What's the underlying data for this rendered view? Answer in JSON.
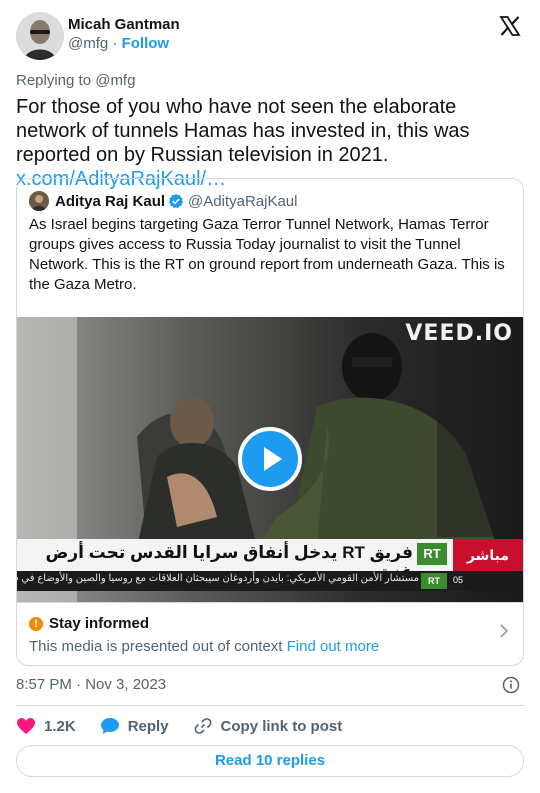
{
  "author": {
    "name": "Micah Gantman",
    "handle": "@mfg",
    "separator": "·",
    "follow_label": "Follow"
  },
  "tweet": {
    "reply_to": "Replying to @mfg",
    "text": "For those of you who have not seen the elaborate network of tunnels Hamas has invested in, this was reported on by Russian television in 2021. ",
    "link": "x.com/AdityaRajKaul/…",
    "timestamp": "8:57 PM · Nov 3, 2023"
  },
  "quote": {
    "name": "Aditya Raj Kaul",
    "handle": "@AdityaRajKaul",
    "text": "As Israel begins targeting Gaza Terror Tunnel Network, Hamas Terror groups gives access to Russia Today journalist to visit the Tunnel Network. This is the RT on ground report from underneath Gaza. This is the Gaza Metro.",
    "media": {
      "watermark": "VEED.IO",
      "banner_text": "فريق RT يدخل أنفاق سرايا القدس تحت أرض غزة",
      "rt_badge": "RT",
      "live_label": "مباشر",
      "ticker_text": "مستشار الأمن القومي الأمريكي: بايدن وأردوغان سيبحثان العلاقات مع روسيا والصين والأوضاع في سوريا وليبيا",
      "ticker_rt": "RT",
      "ticker_time": "05"
    },
    "notice": {
      "title": "Stay informed",
      "body": "This media is presented out of context ",
      "link": "Find out more"
    }
  },
  "actions": {
    "like_count": "1.2K",
    "reply_label": "Reply",
    "copy_label": "Copy link to post"
  },
  "read_replies_label": "Read 10 replies",
  "colors": {
    "accent": "#1d9bf0",
    "like": "#f91880",
    "muted": "#536471",
    "text": "#0f1419",
    "border": "#cfd9de",
    "alert": "#f08a00"
  },
  "icons": [
    "x-logo-icon",
    "verified-badge-icon",
    "play-icon",
    "alert-icon",
    "chevron-right-icon",
    "info-icon",
    "heart-icon",
    "reply-bubble-icon",
    "link-icon"
  ]
}
